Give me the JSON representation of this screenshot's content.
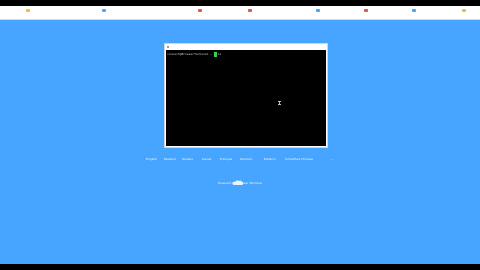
{
  "terminal": {
    "prompt_line": "connect@BrowserTerminal ~ $ ls"
  },
  "language_links": [
    "English",
    "Español",
    "Italiano",
    "Dansk",
    "Français",
    "Deutsch",
    "Espãnol",
    "Simplified Chinese",
    "..."
  ],
  "logo": {
    "caption": "Powered by Browser Terminal"
  },
  "colors": {
    "page_background": "#47a5ff",
    "terminal_background": "#000000",
    "cursor_green": "#39d353"
  }
}
